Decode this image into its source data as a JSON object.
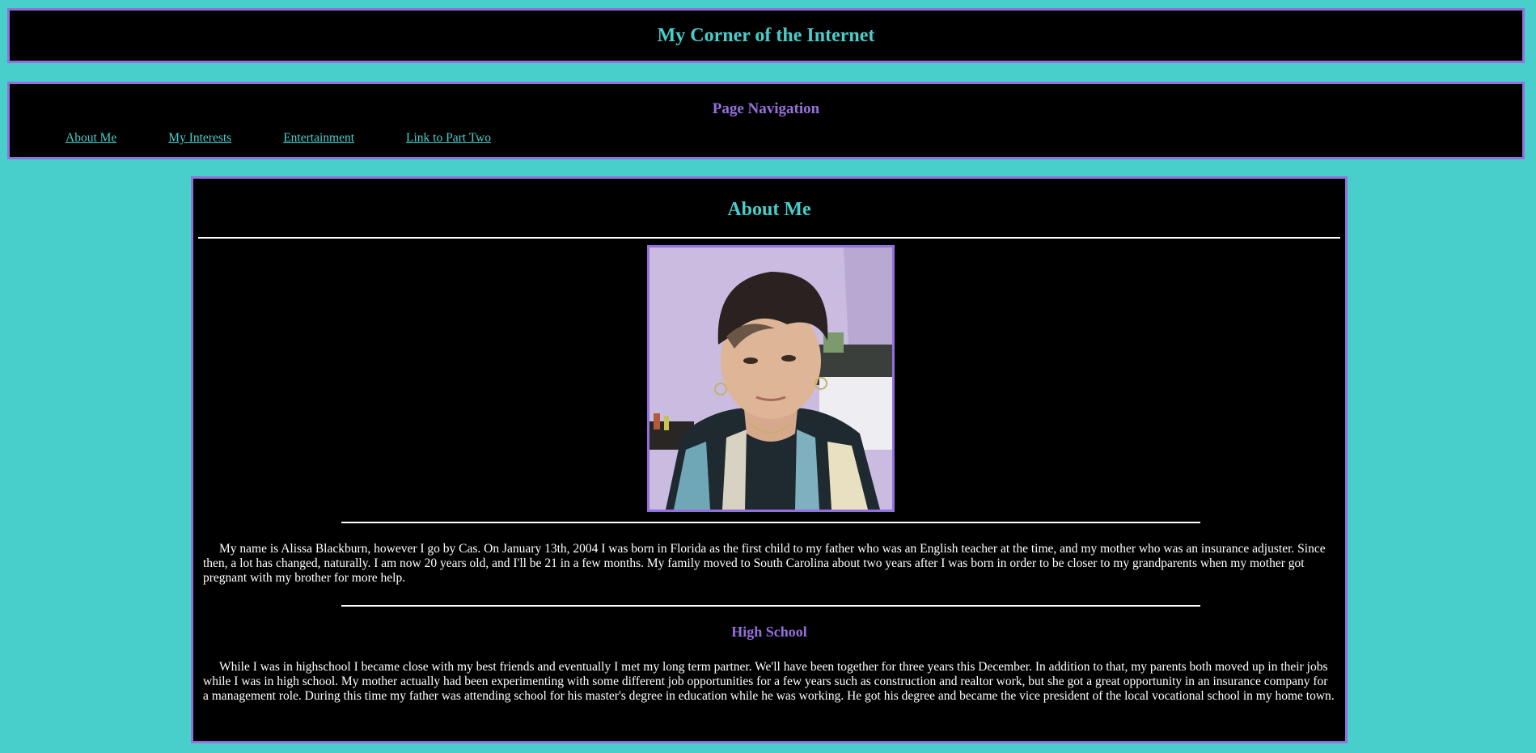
{
  "header": {
    "title": "My Corner of the Internet"
  },
  "nav": {
    "heading": "Page Navigation",
    "links": [
      {
        "label": "About Me"
      },
      {
        "label": "My Interests"
      },
      {
        "label": "Entertainment"
      },
      {
        "label": "Link to Part Two"
      }
    ]
  },
  "about": {
    "title": "About Me",
    "intro": "My name is Alissa Blackburn, however I go by Cas. On January 13th, 2004 I was born in Florida as the first child to my father who was an English teacher at the time, and my mother who was an insurance adjuster. Since then, a lot has changed, naturally. I am now 20 years old, and I'll be 21 in a few months. My family moved to South Carolina about two years after I was born in order to be closer to my grandparents when my mother got pregnant with my brother for more help.",
    "high_school_heading": "High School",
    "high_school_text": "While I was in highschool I became close with my best friends and eventually I met my long term partner. We'll have been together for three years this December. In addition to that, my parents both moved up in their jobs while I was in high school. My mother actually had been experimenting with some different job opportunities for a few years such as construction and realtor work, but she got a great opportunity in an insurance company for a management role. During this time my father was attending school for his master's degree in education while he was working. He got his degree and became the vice president of the local vocational school in my home town."
  },
  "colors": {
    "page_bg": "#48cfcb",
    "panel_bg": "#000000",
    "border": "#9370db",
    "accent_teal": "#48cfcb",
    "accent_purple": "#9370db"
  }
}
